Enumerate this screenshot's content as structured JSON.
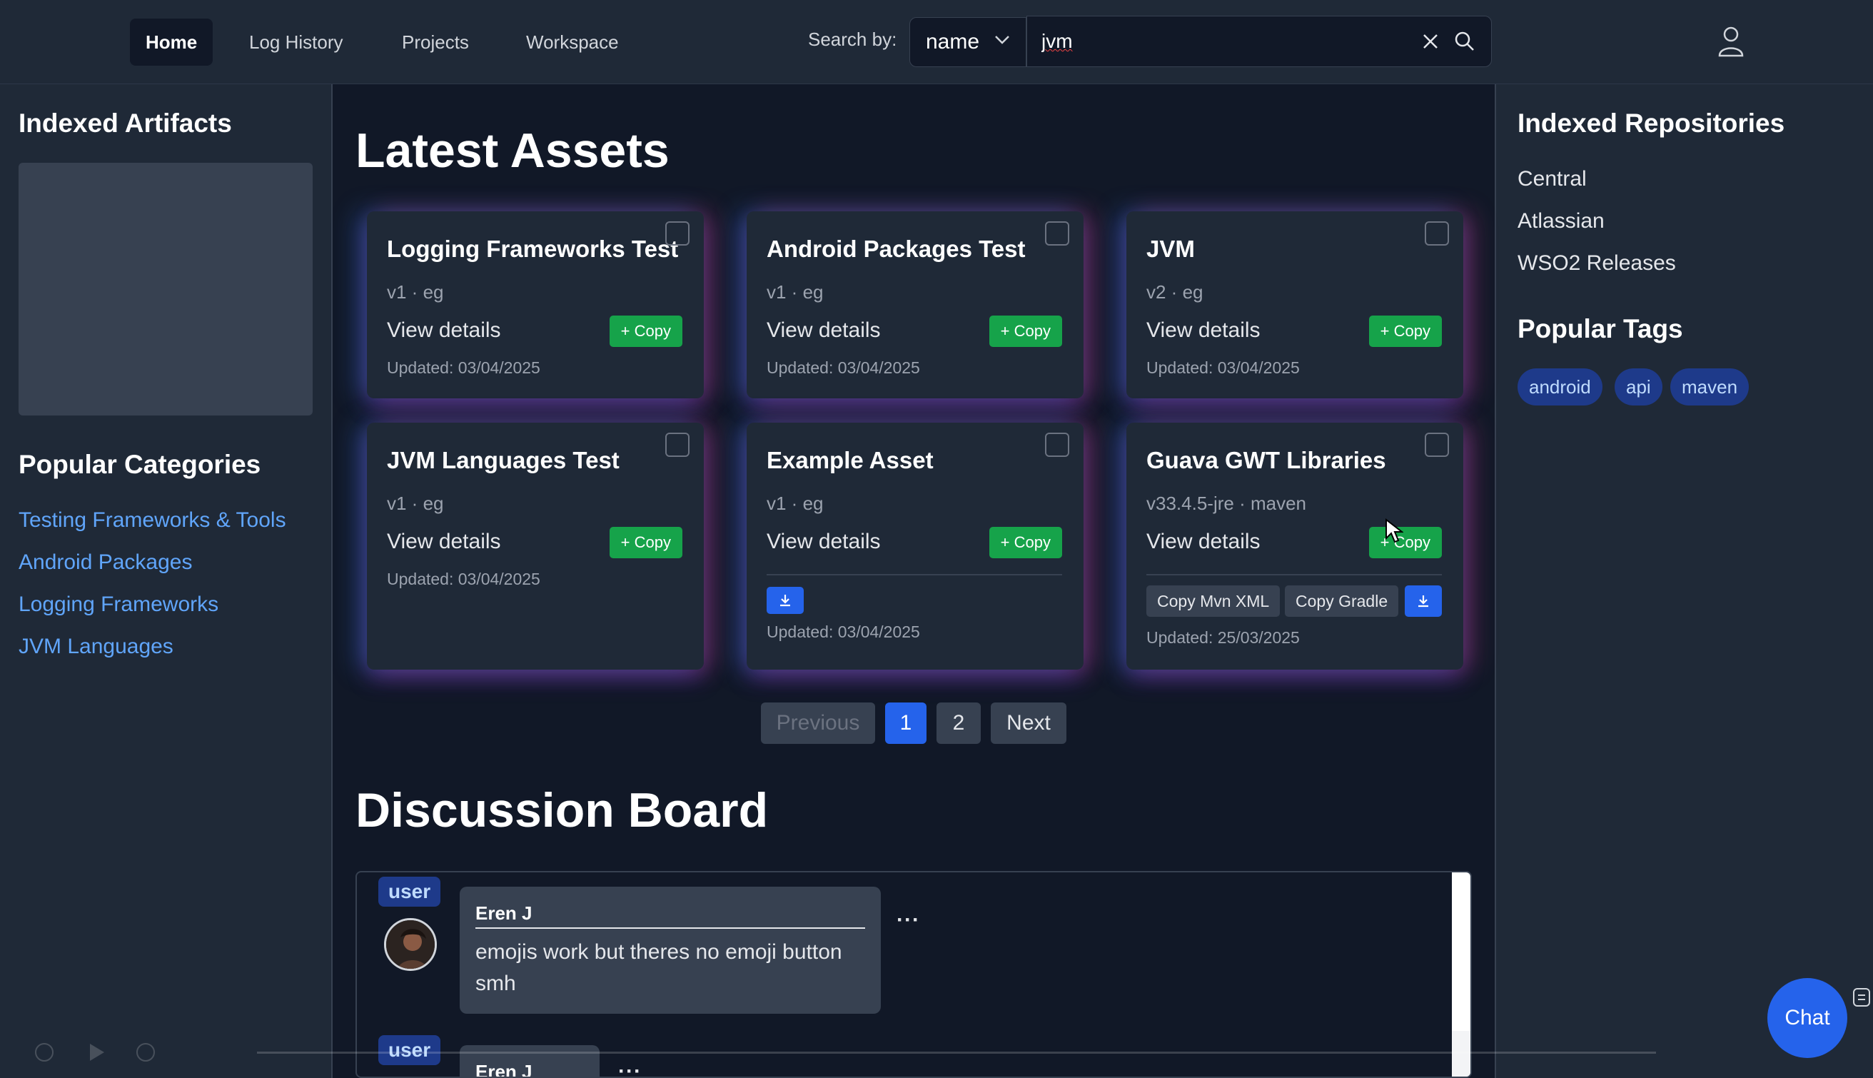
{
  "nav": {
    "items": [
      "Home",
      "Log History",
      "Projects",
      "Workspace"
    ],
    "search_label": "Search by:",
    "search_field": "name",
    "search_value": "jvm"
  },
  "left": {
    "artifacts_title": "Indexed Artifacts",
    "categories_title": "Popular Categories",
    "categories": [
      "Testing Frameworks & Tools",
      "Android Packages",
      "Logging Frameworks",
      "JVM Languages"
    ]
  },
  "right": {
    "repos_title": "Indexed Repositories",
    "repos": [
      "Central",
      "Atlassian",
      "WSO2 Releases"
    ],
    "tags_title": "Popular Tags",
    "tags": [
      "android",
      "api",
      "maven"
    ]
  },
  "main": {
    "title": "Latest Assets",
    "view_label": "View details",
    "copy_label": "+ Copy",
    "copy_mvn_label": "Copy Mvn XML",
    "copy_gradle_label": "Copy Gradle",
    "cards": [
      {
        "title": "Logging Frameworks Test",
        "meta": "v1 · eg",
        "updated": "Updated: 03/04/2025"
      },
      {
        "title": "Android Packages Test",
        "meta": "v1 · eg",
        "updated": "Updated: 03/04/2025"
      },
      {
        "title": "JVM",
        "meta": "v2 · eg",
        "updated": "Updated: 03/04/2025"
      },
      {
        "title": "JVM Languages Test",
        "meta": "v1 · eg",
        "updated": "Updated: 03/04/2025"
      },
      {
        "title": "Example Asset",
        "meta": "v1 · eg",
        "updated": "Updated: 03/04/2025"
      },
      {
        "title": "Guava GWT Libraries",
        "meta": "v33.4.5-jre · maven",
        "updated": "Updated: 25/03/2025"
      }
    ],
    "pagination": {
      "previous": "Previous",
      "pages": [
        "1",
        "2"
      ],
      "current": "1",
      "next": "Next"
    }
  },
  "board": {
    "title": "Discussion Board",
    "posts": [
      {
        "badge": "user",
        "author": "Eren J",
        "message": "emojis work but theres no emoji button smh"
      },
      {
        "badge": "user",
        "author": "Eren J",
        "message": ""
      }
    ],
    "more_label": "···"
  },
  "chat": {
    "label": "Chat"
  },
  "colors": {
    "accent": "#2563eb",
    "copy_green": "#16a34a",
    "link_blue": "#60a5fa",
    "background": "#111827",
    "panel": "#1f2937"
  },
  "icons": [
    "chevron-down-icon",
    "clear-icon",
    "search-icon",
    "user-icon",
    "download-icon",
    "chat-expand-icon",
    "cursor-icon"
  ]
}
